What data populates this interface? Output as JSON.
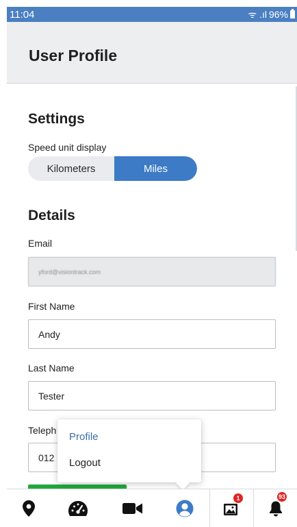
{
  "status_bar": {
    "time": "11:04",
    "signal": "ᯤ .ıl",
    "battery_percent": "96%"
  },
  "header": {
    "title": "User Profile"
  },
  "settings": {
    "section_title": "Settings",
    "speed_label": "Speed unit display",
    "options": [
      "Kilometers",
      "Miles"
    ],
    "selected": "Miles"
  },
  "details": {
    "section_title": "Details",
    "email_label": "Email",
    "email_value": "yford@visiontrack.com",
    "first_name_label": "First Name",
    "first_name_value": "Andy",
    "last_name_label": "Last Name",
    "last_name_value": "Tester",
    "telephone_label": "Teleph",
    "telephone_value": "012"
  },
  "popup_menu": {
    "items": [
      "Profile",
      "Logout"
    ],
    "active": "Profile"
  },
  "bottom_nav": {
    "items": [
      {
        "name": "map-marker-icon",
        "label": "Locations"
      },
      {
        "name": "speedometer-icon",
        "label": "Dashboard"
      },
      {
        "name": "video-camera-icon",
        "label": "Video"
      },
      {
        "name": "user-circle-icon",
        "label": "Profile"
      },
      {
        "name": "media-gallery-icon",
        "label": "Gallery"
      },
      {
        "name": "bell-icon",
        "label": "Notifications"
      }
    ],
    "gallery_badge": "1",
    "notifications_badge": "93"
  },
  "colors": {
    "accent": "#3d7bc7",
    "status_bar": "#4a7fc2",
    "badge": "#e02424",
    "save_button": "#20a83a",
    "menu_active": "#3a6ea8"
  }
}
